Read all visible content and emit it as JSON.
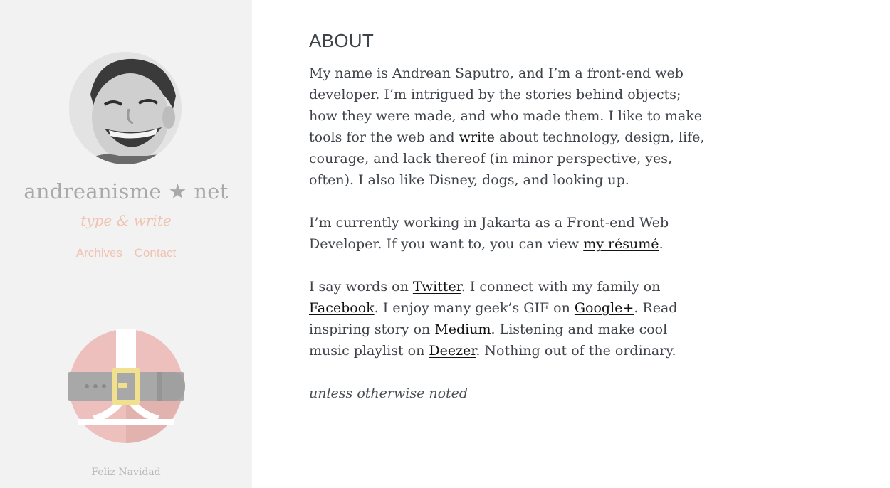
{
  "sidebar": {
    "site_title": "andreanisme ★ net",
    "tagline": "type & write",
    "nav": [
      {
        "label": "Archives"
      },
      {
        "label": "Contact"
      }
    ],
    "holiday_caption": "Feliz Navidad",
    "avatar_alt": "avatar photo"
  },
  "main": {
    "title": "ABOUT",
    "p1": {
      "before": "My name is Andrean Saputro, and I’m a front-end web developer. I’m intrigued by the stories behind objects; how they were made, and who made them. I like to make tools for the web and ",
      "link": "write",
      "after": " about technology, design, life, courage, and lack thereof (in minor perspective, yes, often). I also like Disney, dogs, and looking up."
    },
    "p2": {
      "before": "I’m currently working in Jakarta as a Front-end Web Developer. If you want to, you can view ",
      "link": "my résumé",
      "after": "."
    },
    "p3": {
      "t1": "I say words on ",
      "twitter": "Twitter",
      "t2": ". I connect with my family on ",
      "facebook": "Facebook",
      "t3": ". I enjoy many geek’s GIF on ",
      "googleplus": "Google+",
      "t4": ". Read inspiring story on ",
      "medium": "Medium",
      "t5": ". Listening and make cool music playlist on ",
      "deezer": "Deezer",
      "t6": ". Nothing out of the ordinary."
    },
    "signoff": "unless otherwise noted"
  },
  "colors": {
    "sidebar_bg": "#f2f2f2",
    "title_gray": "#a9a9a9",
    "accent_peach": "#f0c3b2",
    "text": "#3e4349",
    "santa_red": "#eec0bd",
    "belt_gray": "#a8a8a8",
    "buckle_yellow": "#f1e08e"
  }
}
